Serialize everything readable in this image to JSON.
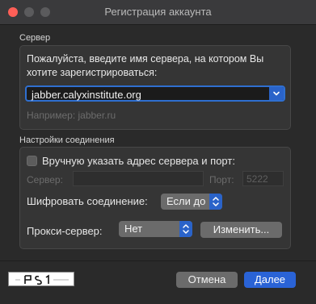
{
  "window": {
    "title": "Регистрация аккаунта"
  },
  "server_section": {
    "label": "Сервер",
    "prompt": "Пожалуйста, введите имя сервера, на котором Вы хотите зарегистрироваться:",
    "server_value": "jabber.calyxinstitute.org",
    "example": "Например: jabber.ru"
  },
  "connection_section": {
    "label": "Настройки соединения",
    "manual_checkbox_label": "Вручную указать адрес сервера и порт:",
    "manual_checked": false,
    "server_label": "Сервер:",
    "server_value": "",
    "port_label": "Порт:",
    "port_placeholder": "5222",
    "encrypt_label": "Шифровать соединение:",
    "encrypt_value": "Если до",
    "proxy_label": "Прокси-сервер:",
    "proxy_value": "Нет",
    "proxy_edit_button": "Изменить..."
  },
  "footer": {
    "captcha_text": "PS1",
    "cancel_button": "Отмена",
    "next_button": "Далее"
  },
  "colors": {
    "accent": "#2a63d6",
    "close": "#ff5f57",
    "background": "#2a2a2a"
  }
}
